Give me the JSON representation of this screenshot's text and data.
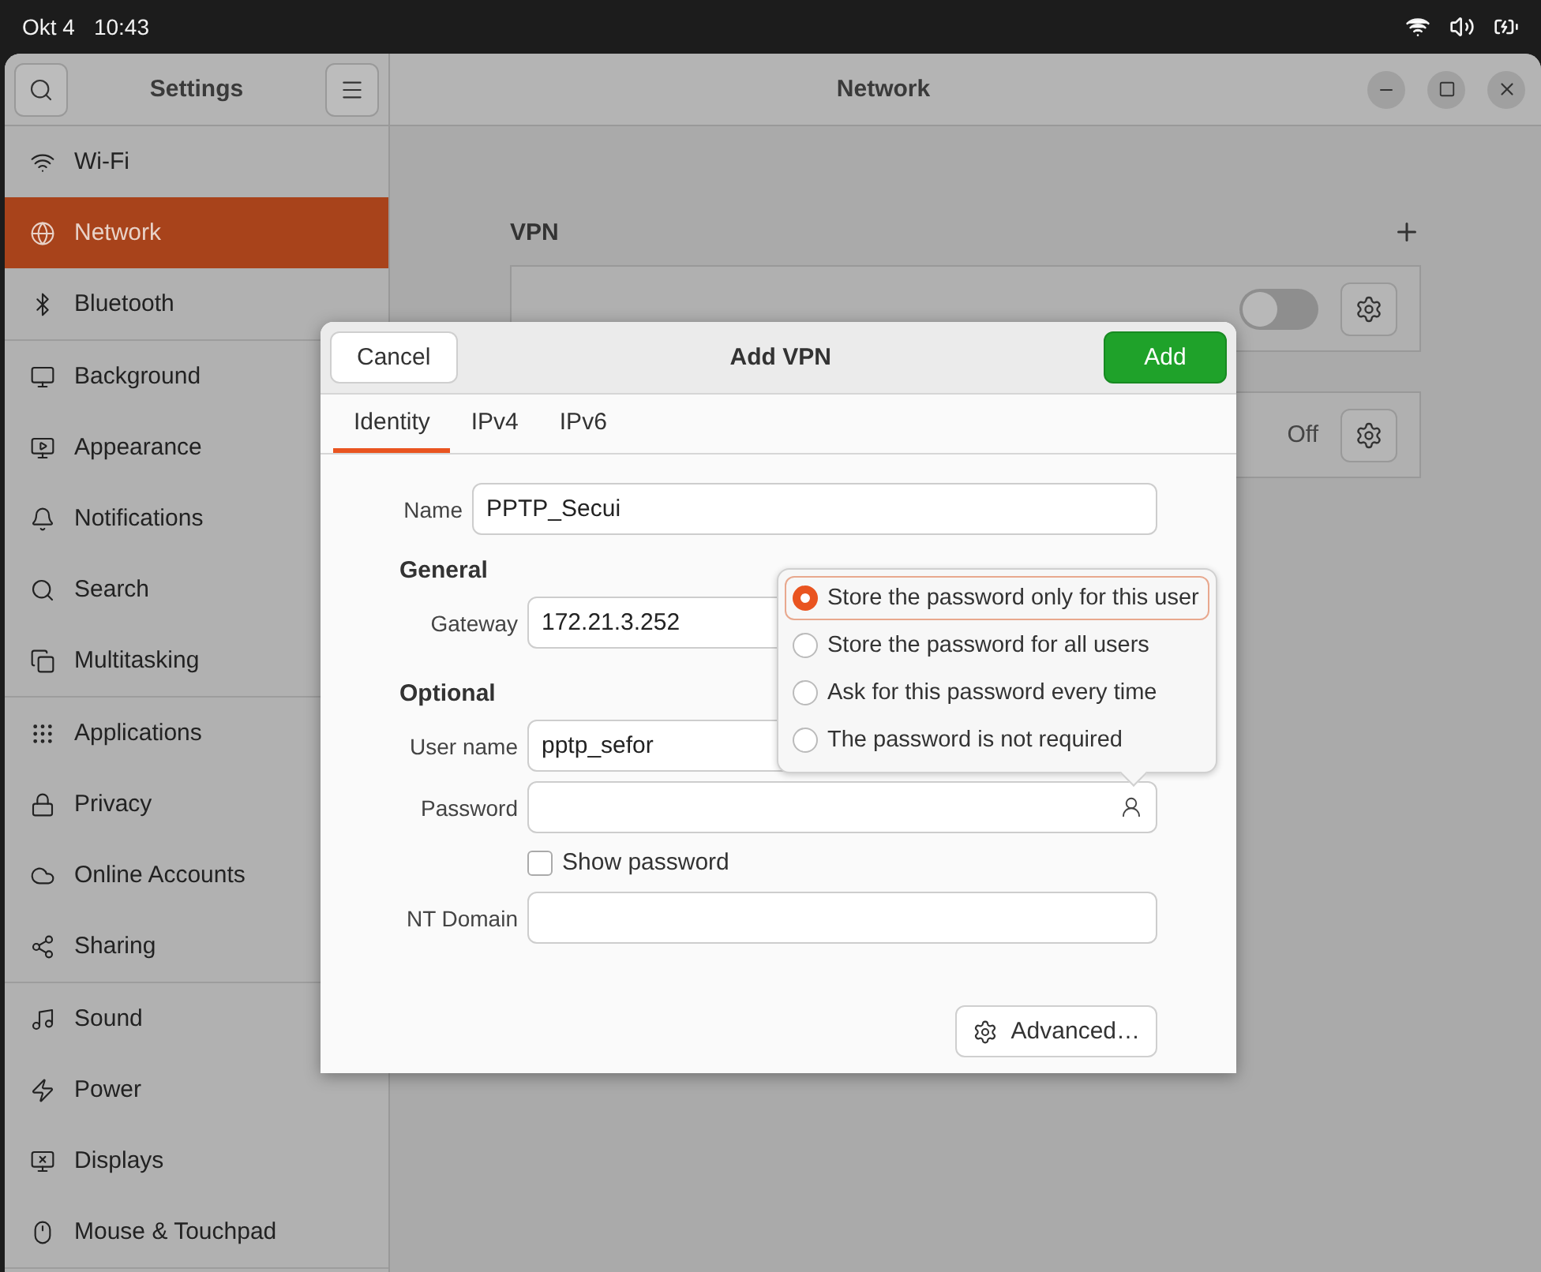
{
  "top_bar": {
    "date": "Okt 4",
    "time": "10:43"
  },
  "sidebar": {
    "title": "Settings",
    "groups": [
      {
        "items": [
          {
            "label": "Wi-Fi",
            "selected": false
          },
          {
            "label": "Network",
            "selected": true
          },
          {
            "label": "Bluetooth",
            "selected": false
          }
        ]
      },
      {
        "items": [
          {
            "label": "Background",
            "selected": false
          },
          {
            "label": "Appearance",
            "selected": false
          },
          {
            "label": "Notifications",
            "selected": false
          },
          {
            "label": "Search",
            "selected": false
          },
          {
            "label": "Multitasking",
            "selected": false
          }
        ]
      },
      {
        "items": [
          {
            "label": "Applications",
            "selected": false
          },
          {
            "label": "Privacy",
            "selected": false
          },
          {
            "label": "Online Accounts",
            "selected": false
          },
          {
            "label": "Sharing",
            "selected": false
          }
        ]
      },
      {
        "items": [
          {
            "label": "Sound",
            "selected": false
          },
          {
            "label": "Power",
            "selected": false
          },
          {
            "label": "Displays",
            "selected": false
          },
          {
            "label": "Mouse & Touchpad",
            "selected": false
          }
        ]
      }
    ]
  },
  "window": {
    "title": "Network"
  },
  "vpn": {
    "heading": "VPN",
    "connections": [
      {
        "on": false
      },
      {
        "status": "Off"
      }
    ]
  },
  "dialog": {
    "title": "Add VPN",
    "cancel": "Cancel",
    "add": "Add",
    "tabs": [
      {
        "label": "Identity",
        "selected": true
      },
      {
        "label": "IPv4",
        "selected": false
      },
      {
        "label": "IPv6",
        "selected": false
      }
    ],
    "name": {
      "label": "Name",
      "value": "PPTP_Secui"
    },
    "general": {
      "heading": "General",
      "gateway": {
        "label": "Gateway",
        "value": "172.21.3.252"
      }
    },
    "optional": {
      "heading": "Optional",
      "username": {
        "label": "User name",
        "value": "pptp_sefor"
      },
      "password": {
        "label": "Password"
      },
      "show_password": {
        "label": "Show password",
        "checked": false
      },
      "nt_domain": {
        "label": "NT Domain"
      }
    },
    "advanced": "Advanced…",
    "password_menu": [
      {
        "label": "Store the password only for this user",
        "selected": true
      },
      {
        "label": "Store the password for all users",
        "selected": false
      },
      {
        "label": "Ask for this password every time",
        "selected": false
      },
      {
        "label": "The password is not required",
        "selected": false
      }
    ]
  }
}
